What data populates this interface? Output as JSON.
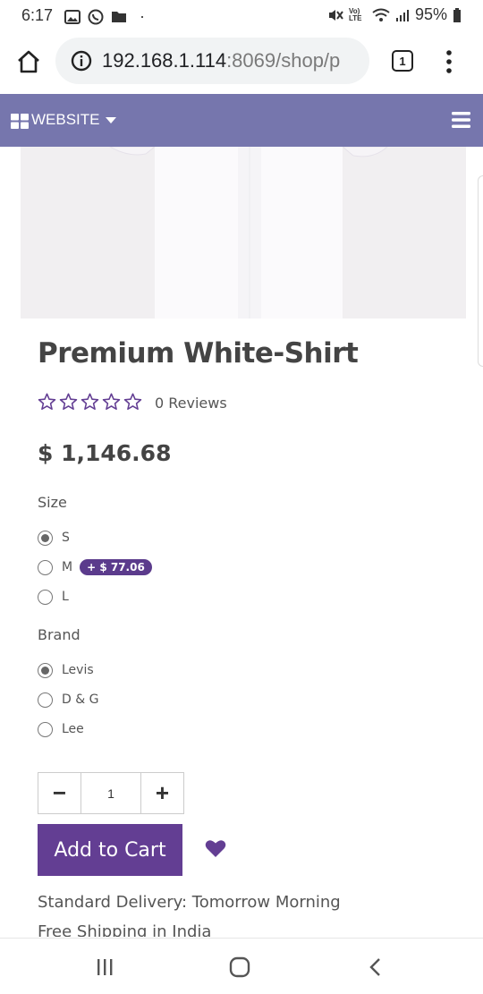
{
  "status_bar": {
    "time": "6:17",
    "signal_label": "Vo) LTE",
    "battery": "95%"
  },
  "browser": {
    "url_host": "192.168.1.114",
    "url_rest": ":8069/shop/p",
    "tab_count": "1"
  },
  "site_nav": {
    "menu_label": "WEBSITE"
  },
  "product": {
    "title": "Premium White-Shirt",
    "rating_stars": 0,
    "reviews": "0 Reviews",
    "price": "$ 1,146.68"
  },
  "variants": {
    "size": {
      "label": "Size",
      "options": [
        {
          "label": "S",
          "selected": true
        },
        {
          "label": "M",
          "selected": false,
          "extra": "+ $ 77.06"
        },
        {
          "label": "L",
          "selected": false
        }
      ]
    },
    "brand": {
      "label": "Brand",
      "options": [
        {
          "label": "Levis",
          "selected": true
        },
        {
          "label": "D & G",
          "selected": false
        },
        {
          "label": "Lee",
          "selected": false
        }
      ]
    }
  },
  "quantity": {
    "value": "1",
    "minus": "−",
    "plus": "+"
  },
  "cart": {
    "add_label": "Add to Cart"
  },
  "delivery": {
    "line1": "Standard Delivery: Tomorrow Morning",
    "line2": "Free Shipping in India"
  },
  "colors": {
    "nav": "#7676ad",
    "primary": "#633e93",
    "badge": "#5b3b8c",
    "heart": "#633e93"
  }
}
